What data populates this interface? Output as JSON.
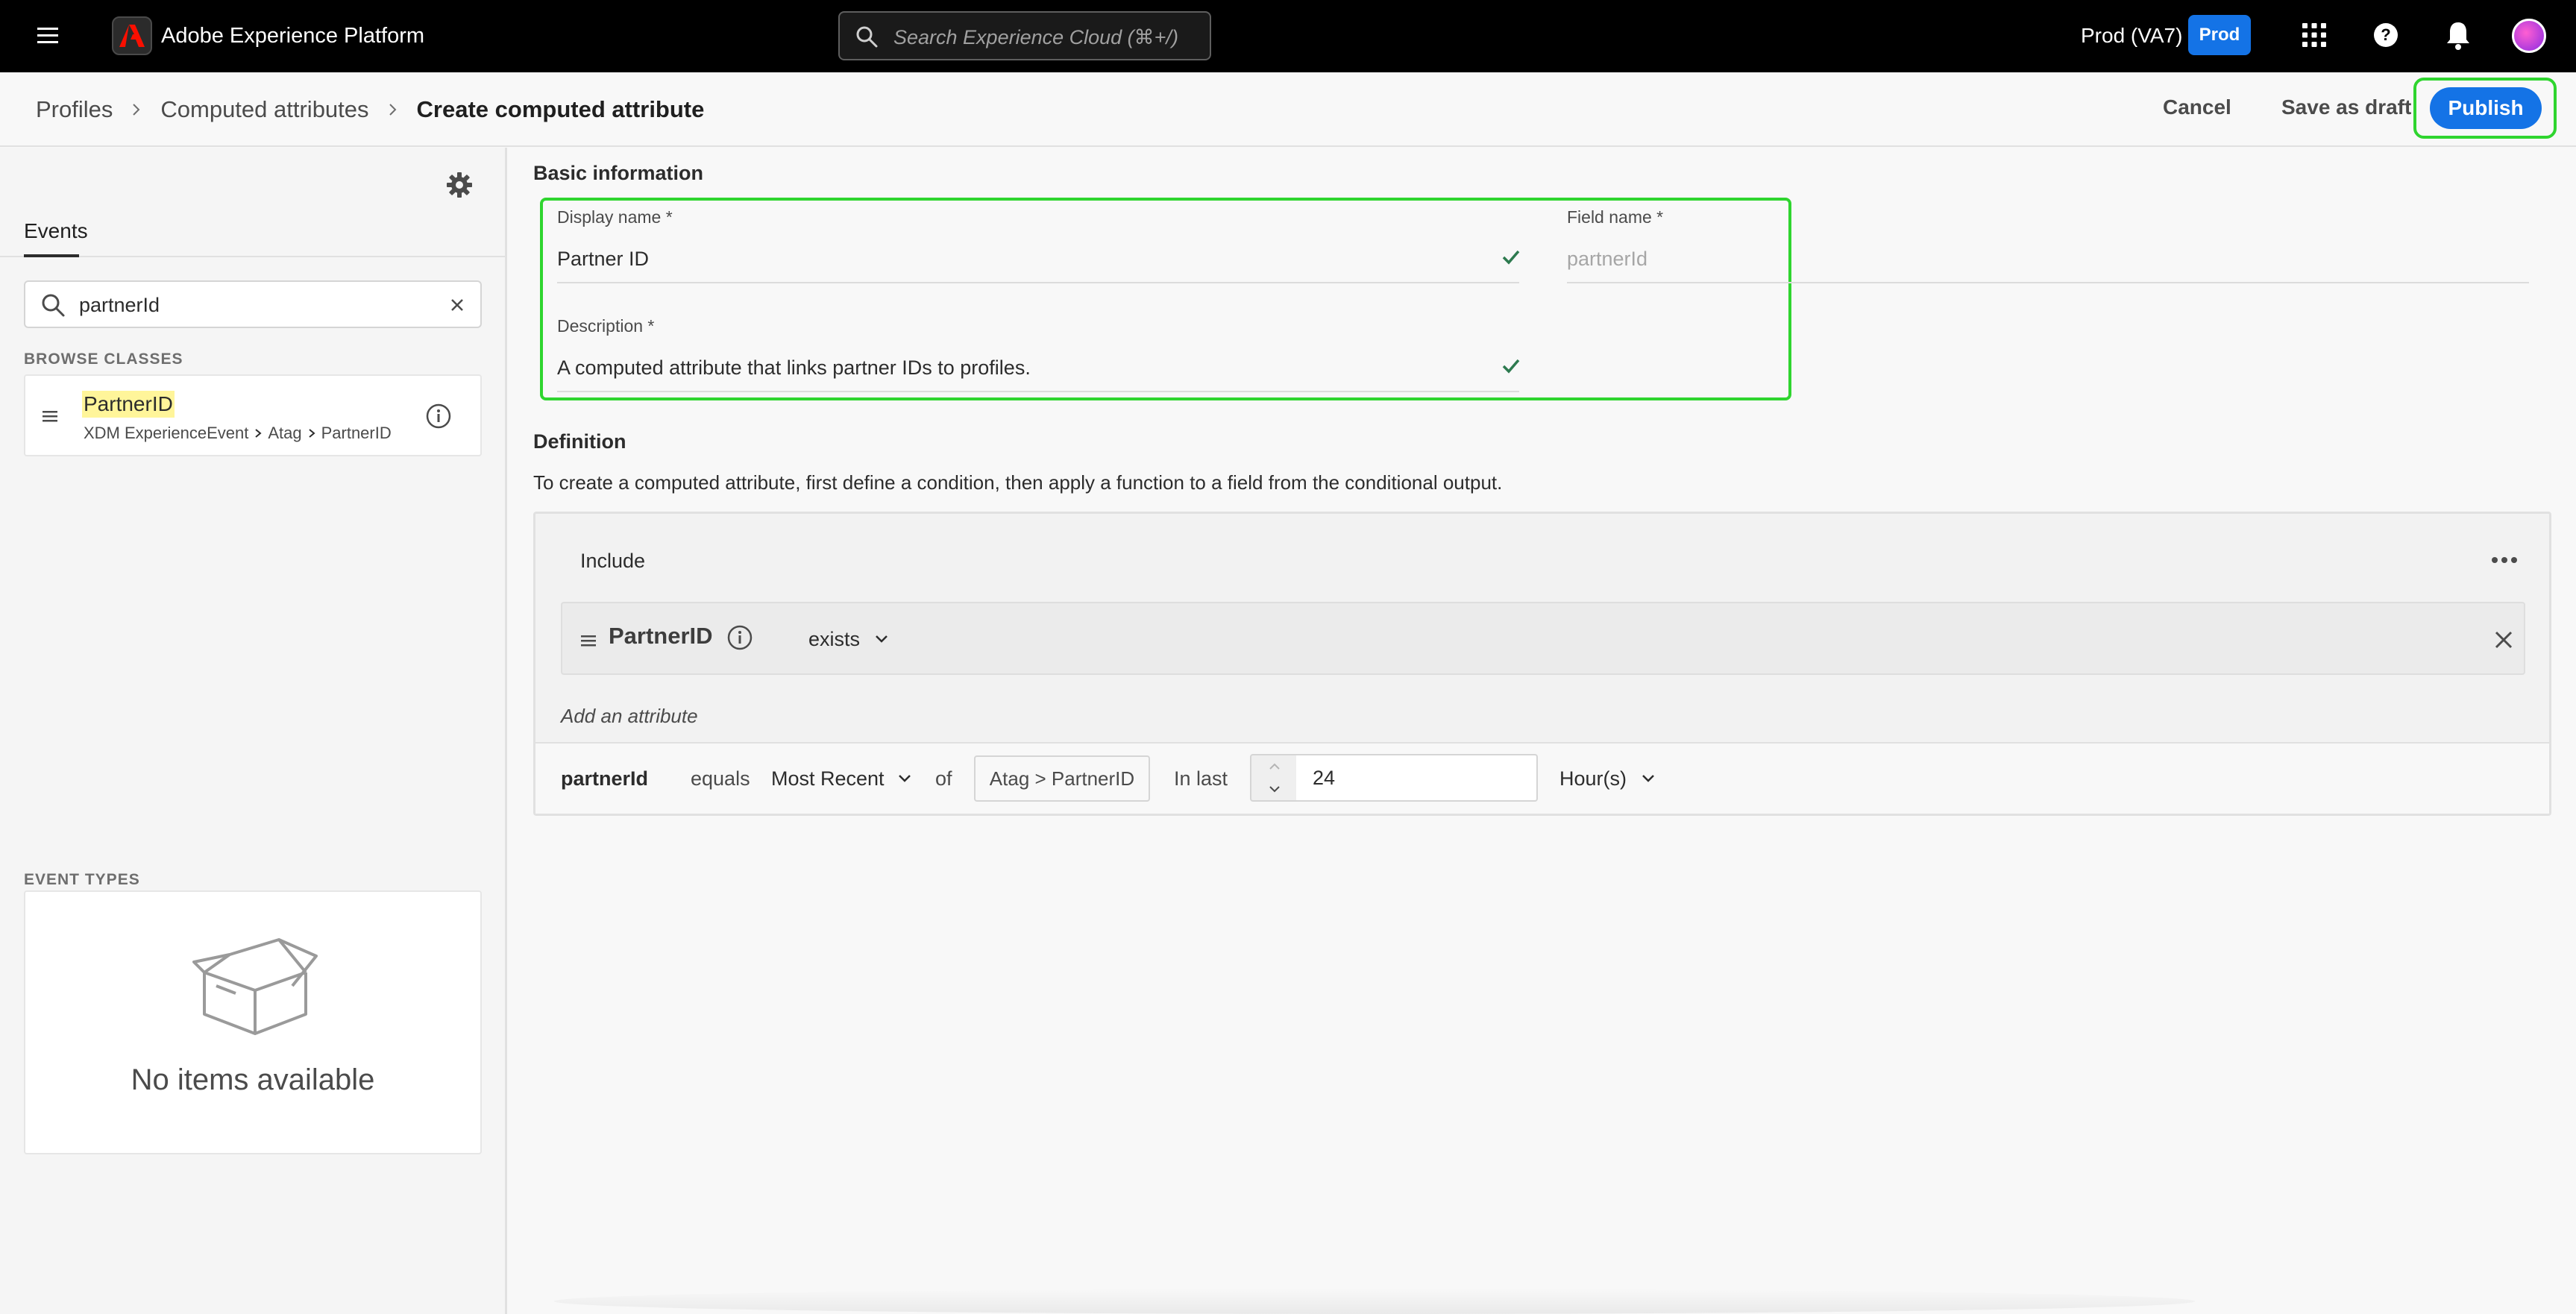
{
  "topbar": {
    "app_title": "Adobe Experience Platform",
    "search_placeholder": "Search Experience Cloud (⌘+/)",
    "sandbox_label": "Prod (VA7)",
    "environment_badge": "Prod",
    "icons": [
      "menu-icon",
      "adobe-logo",
      "search-icon",
      "apps-icon",
      "help-icon",
      "bell-icon",
      "avatar"
    ]
  },
  "breadcrumb": {
    "items": [
      "Profiles",
      "Computed attributes",
      "Create computed attribute"
    ]
  },
  "actions": {
    "cancel": "Cancel",
    "save_draft": "Save as draft",
    "publish": "Publish"
  },
  "left_panel": {
    "tab": "Events",
    "search_value": "partnerId",
    "browse_classes_label": "BROWSE CLASSES",
    "class_item": {
      "name": "PartnerID",
      "path": [
        "XDM ExperienceEvent",
        "Atag",
        "PartnerID"
      ]
    },
    "event_types_label": "EVENT TYPES",
    "empty_state": "No items available"
  },
  "basic_info": {
    "title": "Basic information",
    "display_name_label": "Display name *",
    "display_name_value": "Partner ID",
    "field_name_label": "Field name *",
    "field_name_placeholder": "partnerId",
    "description_label": "Description *",
    "description_value": "A computed attribute that links partner IDs to profiles."
  },
  "definition": {
    "title": "Definition",
    "help_text": "To create a computed attribute, first define a condition, then apply a function to a field from the conditional output.",
    "include_label": "Include",
    "condition": {
      "attribute": "PartnerID",
      "operator": "exists"
    },
    "add_attribute": "Add an attribute",
    "function": {
      "field": "partnerId",
      "equals": "equals",
      "aggregation": "Most Recent",
      "of": "of",
      "path": "Atag > PartnerID",
      "in_last": "In last",
      "amount": "24",
      "unit": "Hour(s)"
    }
  },
  "colors": {
    "topbar_bg": "#000000",
    "accent_blue": "#1473e6",
    "highlight_green": "#2fd52f",
    "search_highlight": "#fff59a",
    "check_green": "#2d7a4f"
  }
}
